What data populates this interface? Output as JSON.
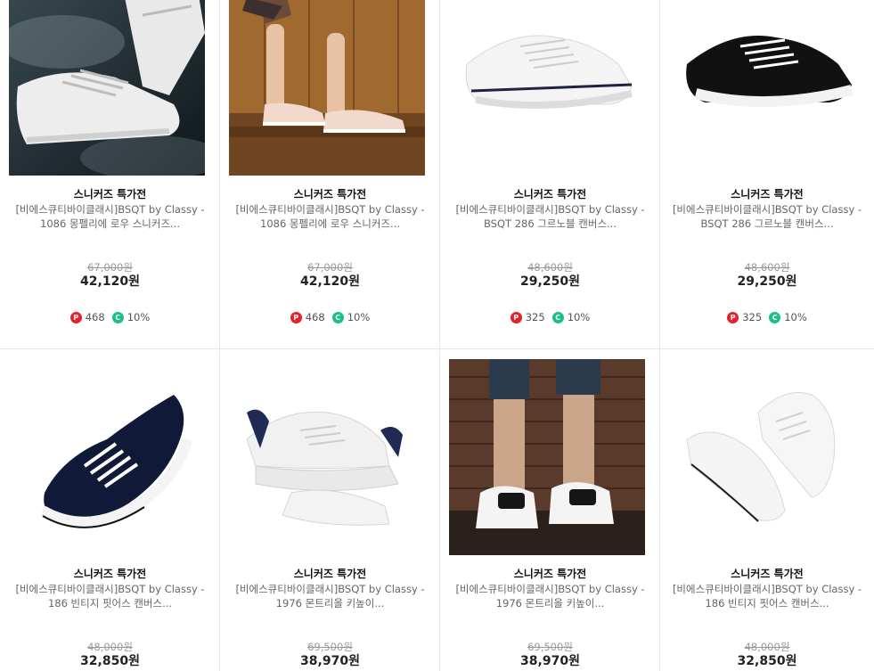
{
  "products": [
    {
      "badge": "스니커즈 특가전",
      "name_line1": "[비에스큐티바이클래시]BSQT by Classy -",
      "name_line2": "1086 몽펠리에 로우 스니커즈...",
      "original_price": "67,000원",
      "price": "42,120원",
      "point": "468",
      "coupon": "10%",
      "point_icon": "P",
      "coupon_icon": "C"
    },
    {
      "badge": "스니커즈 특가전",
      "name_line1": "[비에스큐티바이클래시]BSQT by Classy -",
      "name_line2": "1086 몽펠리에 로우 스니커즈...",
      "original_price": "67,000원",
      "price": "42,120원",
      "point": "468",
      "coupon": "10%",
      "point_icon": "P",
      "coupon_icon": "C"
    },
    {
      "badge": "스니커즈 특가전",
      "name_line1": "[비에스큐티바이클래시]BSQT by Classy -",
      "name_line2": "BSQT 286 그르노블 캔버스...",
      "original_price": "48,600원",
      "price": "29,250원",
      "point": "325",
      "coupon": "10%",
      "point_icon": "P",
      "coupon_icon": "C"
    },
    {
      "badge": "스니커즈 특가전",
      "name_line1": "[비에스큐티바이클래시]BSQT by Classy -",
      "name_line2": "BSQT 286 그르노블 캔버스...",
      "original_price": "48,600원",
      "price": "29,250원",
      "point": "325",
      "coupon": "10%",
      "point_icon": "P",
      "coupon_icon": "C"
    },
    {
      "badge": "스니커즈 특가전",
      "name_line1": "[비에스큐티바이클래시]BSQT by Classy -",
      "name_line2": "186 빈티지 핏어스 캔버스...",
      "original_price": "48,000원",
      "price": "32,850원"
    },
    {
      "badge": "스니커즈 특가전",
      "name_line1": "[비에스큐티바이클래시]BSQT by Classy -",
      "name_line2": "1976 몬트리올 키높이...",
      "original_price": "69,500원",
      "price": "38,970원"
    },
    {
      "badge": "스니커즈 특가전",
      "name_line1": "[비에스큐티바이클래시]BSQT by Classy -",
      "name_line2": "1976 몬트리올 키높이...",
      "original_price": "69,500원",
      "price": "38,970원"
    },
    {
      "badge": "스니커즈 특가전",
      "name_line1": "[비에스큐티바이클래시]BSQT by Classy -",
      "name_line2": "186 빈티지 핏어스 캔버스...",
      "original_price": "48,000원",
      "price": "32,850원"
    }
  ],
  "colors": {
    "point_badge": "#e8202a",
    "coupon_badge": "#19c08a",
    "divider": "#e6e6e6"
  }
}
